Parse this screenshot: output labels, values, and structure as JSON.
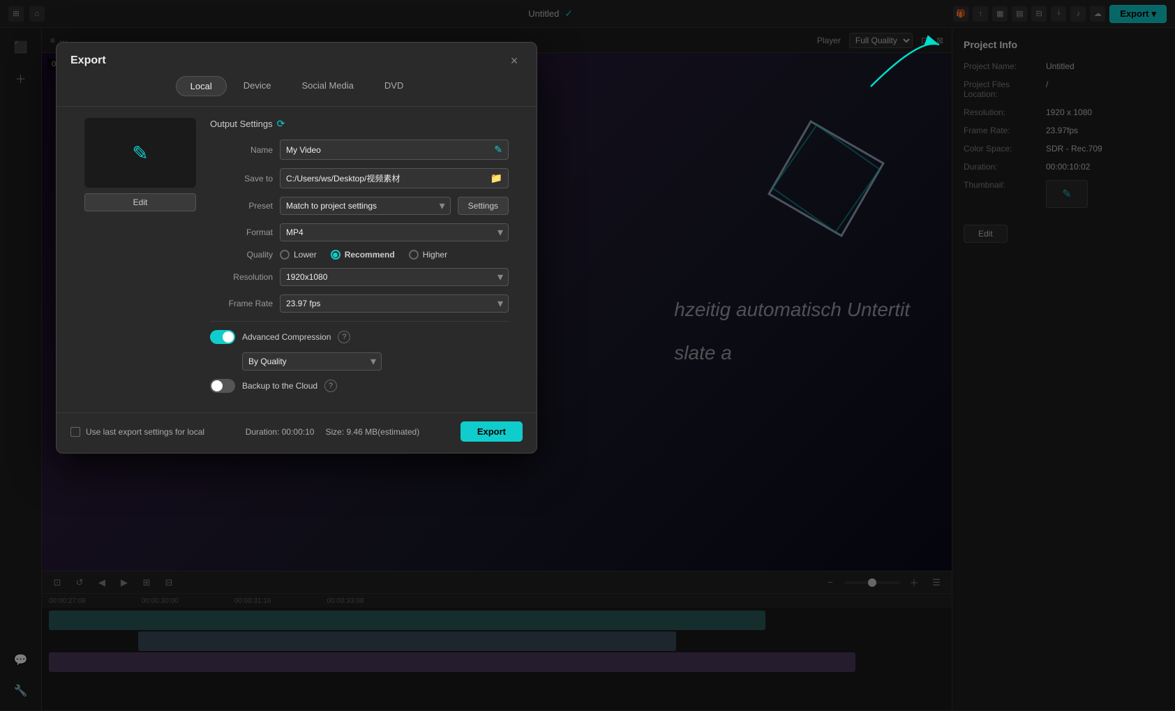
{
  "topbar": {
    "title": "Untitled",
    "export_label": "Export",
    "player_label": "Player",
    "quality_label": "Full Quality"
  },
  "right_panel": {
    "title": "Project Info",
    "project_name_label": "Project Name:",
    "project_name_value": "Untitled",
    "files_location_label": "Project Files Location:",
    "files_location_value": "/",
    "resolution_label": "Resolution:",
    "resolution_value": "1920 x 1080",
    "frame_rate_label": "Frame Rate:",
    "frame_rate_value": "23.97fps",
    "color_space_label": "Color Space:",
    "color_space_value": "SDR - Rec.709",
    "duration_label": "Duration:",
    "duration_value": "00:00:10:02",
    "thumbnail_label": "Thumbnail:",
    "edit_label": "Edit"
  },
  "export_dialog": {
    "title": "Export",
    "close_label": "×",
    "tabs": [
      "Local",
      "Device",
      "Social Media",
      "DVD"
    ],
    "active_tab": "Local",
    "output_settings_label": "Output Settings",
    "name_label": "Name",
    "name_value": "My Video",
    "save_to_label": "Save to",
    "save_to_value": "C:/Users/ws/Desktop/视频素材",
    "preset_label": "Preset",
    "preset_value": "Match to project settings",
    "settings_btn_label": "Settings",
    "format_label": "Format",
    "format_value": "MP4",
    "quality_label": "Quality",
    "quality_options": [
      {
        "label": "Lower",
        "checked": false
      },
      {
        "label": "Recommend",
        "checked": true
      },
      {
        "label": "Higher",
        "checked": false
      }
    ],
    "resolution_label": "Resolution",
    "resolution_value": "1920x1080",
    "frame_rate_label": "Frame Rate",
    "frame_rate_value": "23.97 fps",
    "advanced_compression_label": "Advanced Compression",
    "advanced_compression_enabled": true,
    "by_quality_label": "By Quality",
    "backup_cloud_label": "Backup to the Cloud",
    "backup_cloud_enabled": false,
    "use_last_settings_label": "Use last export settings for local",
    "duration_label": "Duration: 00:00:10",
    "size_label": "Size: 9.46 MB(estimated)",
    "export_btn_label": "Export"
  },
  "timeline": {
    "timestamps": [
      "00:00:27:08",
      "00:00:30:00",
      "00:00:31:16",
      "00:00:33:08"
    ]
  },
  "colors": {
    "accent": "#1cc",
    "bg_dark": "#1a1a1a",
    "bg_medium": "#222",
    "bg_light": "#2a2a2a",
    "border": "#333",
    "text_primary": "#eee",
    "text_secondary": "#aaa",
    "text_muted": "#666"
  }
}
